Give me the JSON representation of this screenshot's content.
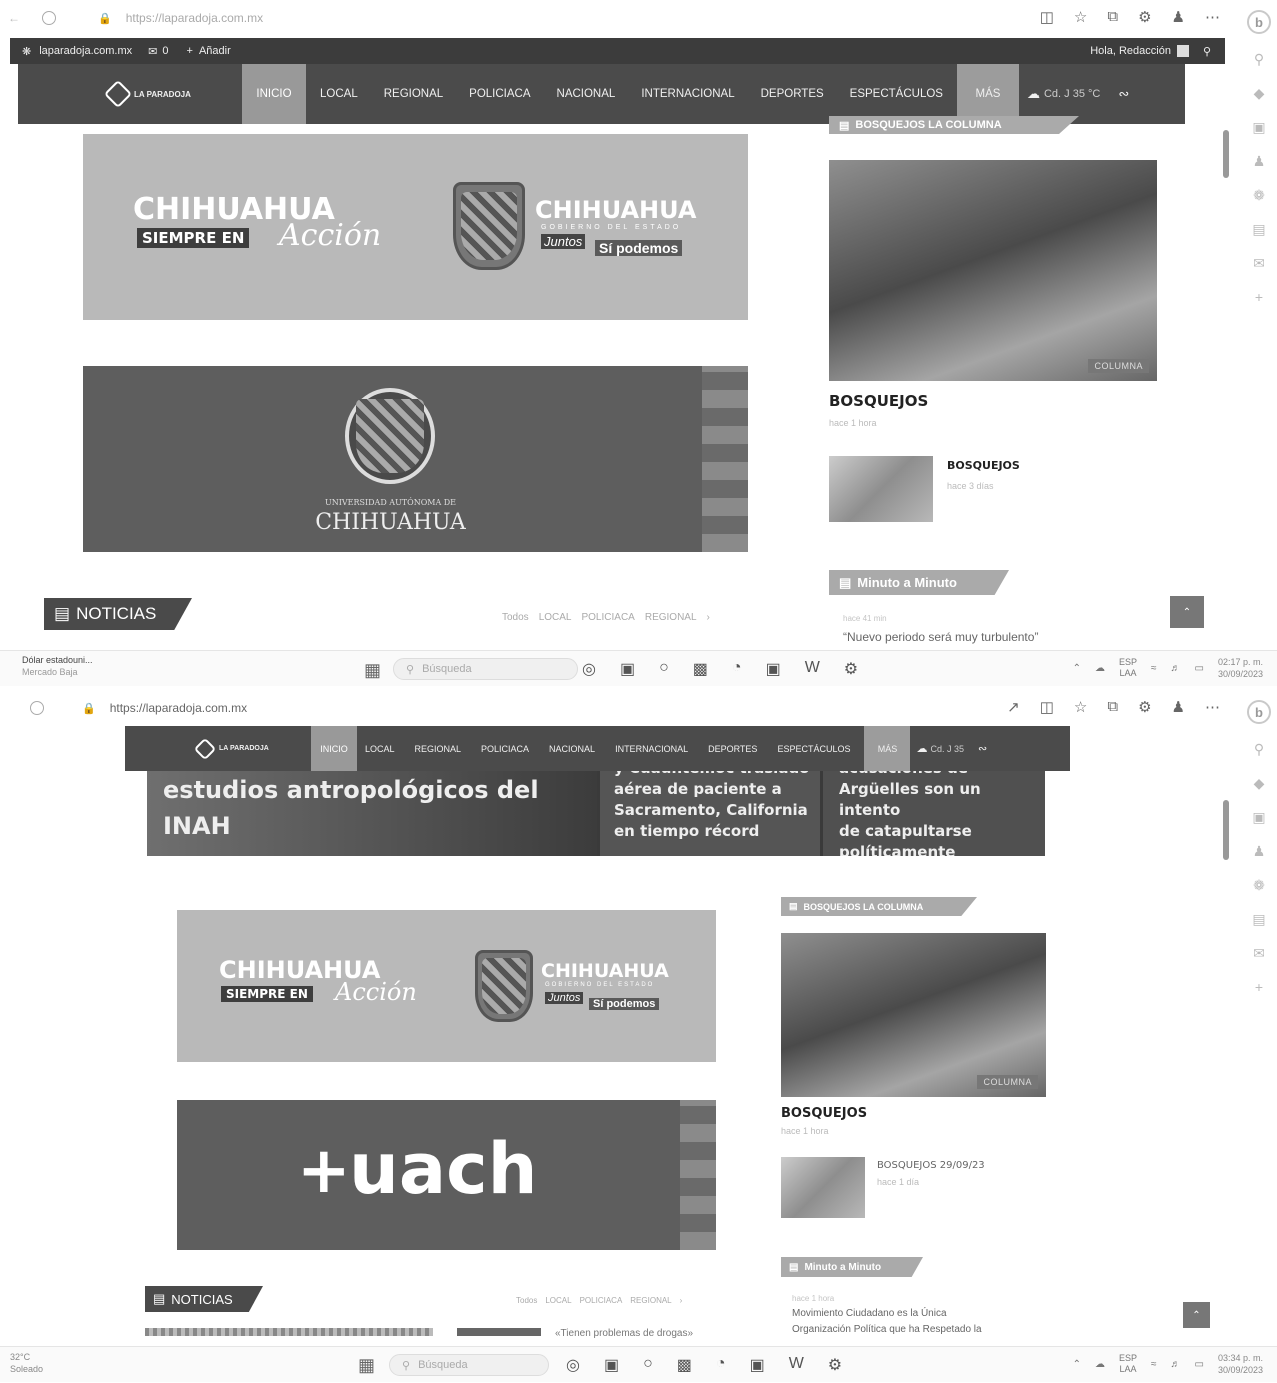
{
  "top": {
    "url": "https://laparadoja.com.mx",
    "admin": {
      "site": "laparadoja.com.mx",
      "comments": "0",
      "add": "Añadir",
      "greeting": "Hola, Redacción"
    },
    "nav": [
      "INICIO",
      "LOCAL",
      "REGIONAL",
      "POLICIACA",
      "NACIONAL",
      "INTERNACIONAL",
      "DEPORTES",
      "ESPECTÁCULOS",
      "MÁS"
    ],
    "weather": "Cd. J 35 °C",
    "banner1": {
      "title": "CHIHUAHUA",
      "sub": "SIEMPRE EN",
      "script": "Acción",
      "state": "CHIHUAHUA",
      "gov": "GOBIERNO DEL ESTADO",
      "juntos": "Juntos",
      "podemos": "Sí podemos"
    },
    "banner2": {
      "uni": "UNIVERSIDAD AUTÓNOMA DE",
      "name": "CHIHUAHUA"
    },
    "sidebar": {
      "section": "BOSQUEJOS LA COLUMNA",
      "photo_tag": "COLUMNA",
      "headline": "BOSQUEJOS",
      "headline_meta": "hace 1 hora",
      "small_title": "BOSQUEJOS",
      "small_meta": "hace 3 días",
      "mam": "Minuto a Minuto",
      "mam_meta": "hace 41 min",
      "mam_text": "“Nuevo periodo será muy turbulento”"
    },
    "noticias": "NOTICIAS",
    "filters": [
      "Todos",
      "LOCAL",
      "POLICIACA",
      "REGIONAL"
    ],
    "taskbar": {
      "widget_title": "Dólar estadouni...",
      "widget_sub": "Mercado Baja",
      "search": "Búsqueda",
      "lang": "ESP",
      "lang2": "LAA",
      "time": "02:17 p. m.",
      "date": "30/09/2023"
    }
  },
  "bottom": {
    "url": "https://laparadoja.com.mx",
    "nav": [
      "INICIO",
      "LOCAL",
      "REGIONAL",
      "POLICIACA",
      "NACIONAL",
      "INTERNACIONAL",
      "DEPORTES",
      "ESPECTÁCULOS",
      "MÁS"
    ],
    "weather": "Cd. J 35",
    "news": [
      {
        "lines": [
          "estudios antropológicos del",
          "INAH"
        ]
      },
      {
        "lines": [
          "y Cuauhtémoc traslado",
          "aérea de paciente a",
          "Sacramento, California",
          "en tiempo récord"
        ]
      },
      {
        "lines": [
          "acusaciones de",
          "Argüelles son un intento",
          "de catapultarse",
          "políticamente"
        ]
      }
    ],
    "banner1": {
      "title": "CHIHUAHUA",
      "sub": "SIEMPRE EN",
      "script": "Acción",
      "state": "CHIHUAHUA",
      "gov": "GOBIERNO DEL ESTADO",
      "juntos": "Juntos",
      "podemos": "Sí podemos"
    },
    "banner2": {
      "plus": "+",
      "name": "uach"
    },
    "sidebar": {
      "section": "BOSQUEJOS LA COLUMNA",
      "photo_tag": "COLUMNA",
      "headline": "BOSQUEJOS",
      "headline_meta": "hace 1 hora",
      "small_title": "BOSQUEJOS 29/09/23",
      "small_meta": "hace 1 día",
      "mam": "Minuto a Minuto",
      "mam_meta": "hace 1 hora",
      "mam_text1": "Movimiento Ciudadano es la Única",
      "mam_text2": "Organización Política que ha Respetado la"
    },
    "noticias": "NOTICIAS",
    "filters": [
      "Todos",
      "LOCAL",
      "POLICIACA",
      "REGIONAL"
    ],
    "teaser": "«Tienen problemas de drogas»",
    "taskbar": {
      "weather_temp": "32°C",
      "weather_desc": "Soleado",
      "search": "Búsqueda",
      "lang": "ESP",
      "lang2": "LAA",
      "time": "03:34 p. m.",
      "date": "30/09/2023"
    }
  }
}
